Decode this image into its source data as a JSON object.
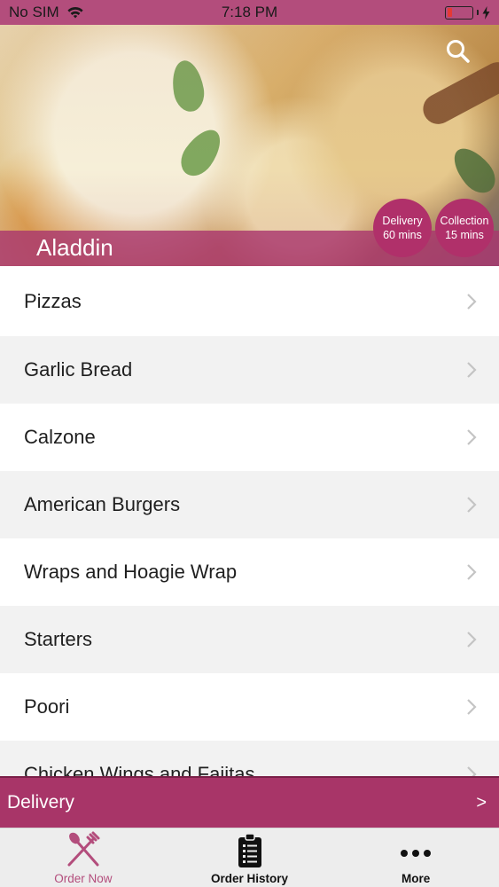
{
  "status_bar": {
    "carrier": "No SIM",
    "time": "7:18 PM"
  },
  "hero": {
    "restaurant_name": "Aladdin",
    "delivery_badge": {
      "line1": "Delivery",
      "line2": "60 mins"
    },
    "collection_badge": {
      "line1": "Collection",
      "line2": "15 mins"
    }
  },
  "menu": {
    "items": [
      {
        "label": "Pizzas"
      },
      {
        "label": "Garlic Bread"
      },
      {
        "label": "Calzone"
      },
      {
        "label": "American Burgers"
      },
      {
        "label": "Wraps and Hoagie Wrap"
      },
      {
        "label": "Starters"
      },
      {
        "label": "Poori"
      },
      {
        "label": "Chicken Wings and Fajitas"
      }
    ]
  },
  "delivery_bar": {
    "label": "Delivery",
    "arrow": ">"
  },
  "tabs": [
    {
      "label": "Order Now",
      "icon": "fork-knife-icon",
      "active": true
    },
    {
      "label": "Order History",
      "icon": "clipboard-list-icon",
      "active": false
    },
    {
      "label": "More",
      "icon": "more-dots-icon",
      "active": false
    }
  ],
  "colors": {
    "brand": "#b34d7c",
    "delivery_bar": "#a83568",
    "badge": "#b0306a",
    "battery": "#e53935"
  }
}
